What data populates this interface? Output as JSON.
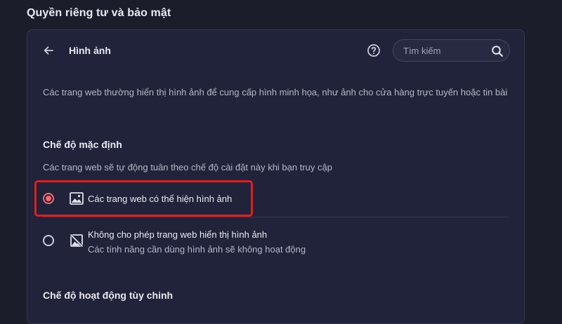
{
  "page": {
    "section_title": "Quyền riêng tư và bảo mật"
  },
  "header": {
    "back_icon": "arrow-left-icon",
    "title": "Hình ảnh",
    "help_icon": "help-circle-icon",
    "search": {
      "placeholder": "Tìm kiếm",
      "value": "",
      "icon": "search-icon"
    }
  },
  "description": "Các trang web thường hiển thị hình ảnh để cung cấp hình minh họa, như ảnh cho cửa hàng trực tuyến hoặc tin bài",
  "default_behavior": {
    "heading": "Chế độ mặc định",
    "subtext": "Các trang web sẽ tự động tuân theo chế độ cài đặt này khi bạn truy cập",
    "options": [
      {
        "label": "Các trang web có thể hiện hình ảnh",
        "subtext": "",
        "icon": "image-icon",
        "selected": true
      },
      {
        "label": "Không cho phép trang web hiển thị hình ảnh",
        "subtext": "Các tính năng cần dùng hình ảnh sẽ không hoạt động",
        "icon": "image-off-icon",
        "selected": false
      }
    ]
  },
  "custom_behavior": {
    "heading": "Chế độ hoạt động tùy chinh"
  },
  "colors": {
    "page_bg": "#1b1d2b",
    "panel_bg": "#21233a",
    "accent_radio": "#f26b72",
    "highlight_box": "#e01e1e",
    "text_primary": "#e9eaf0",
    "text_secondary": "#b4b7c7"
  }
}
